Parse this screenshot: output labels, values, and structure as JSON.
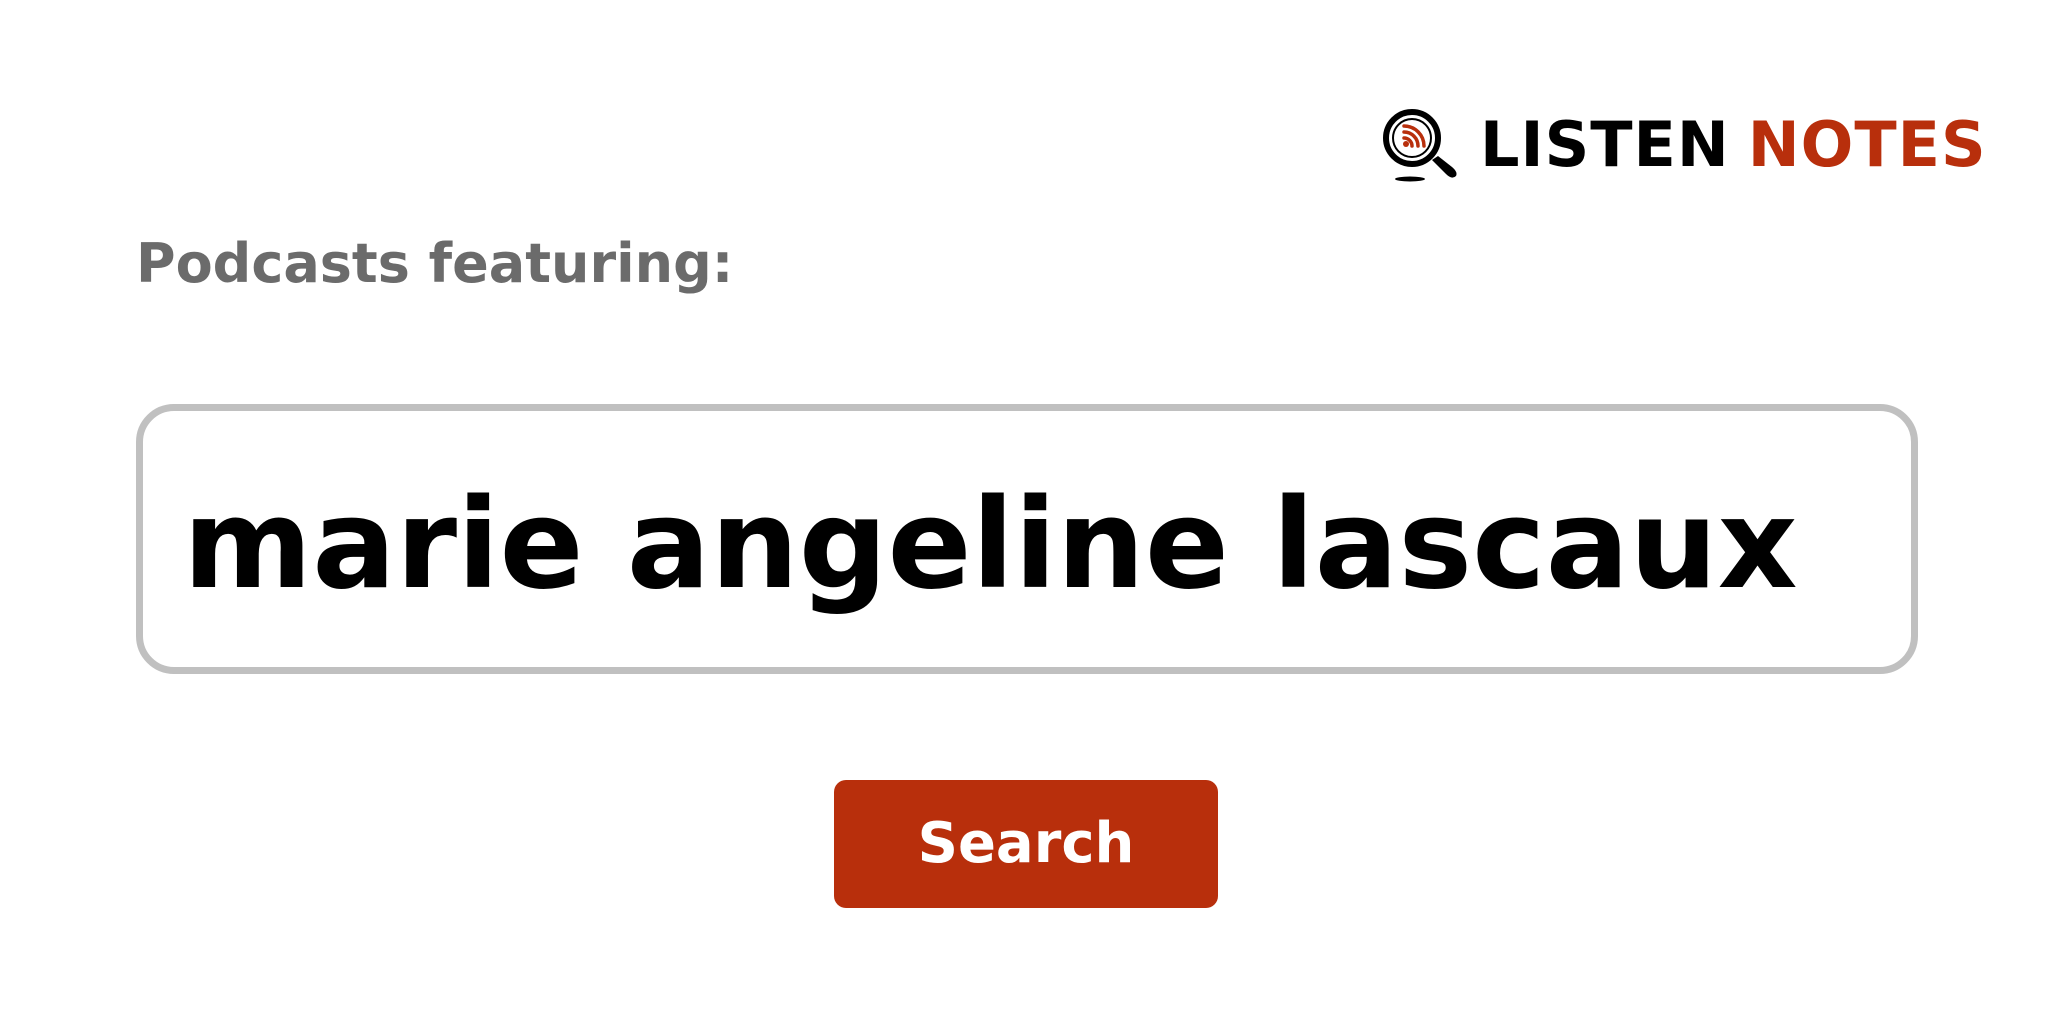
{
  "logo": {
    "word1": "LISTEN",
    "word2": "NOTES",
    "icon": "podcast-search-icon",
    "colors": {
      "dark": "#000000",
      "brand": "#b82f0c"
    }
  },
  "intro_label": "Podcasts featuring:",
  "search": {
    "value": "marie angeline lascaux",
    "border_color": "#c0c0c0"
  },
  "search_button": {
    "label": "Search",
    "color": "#b82f0c"
  }
}
